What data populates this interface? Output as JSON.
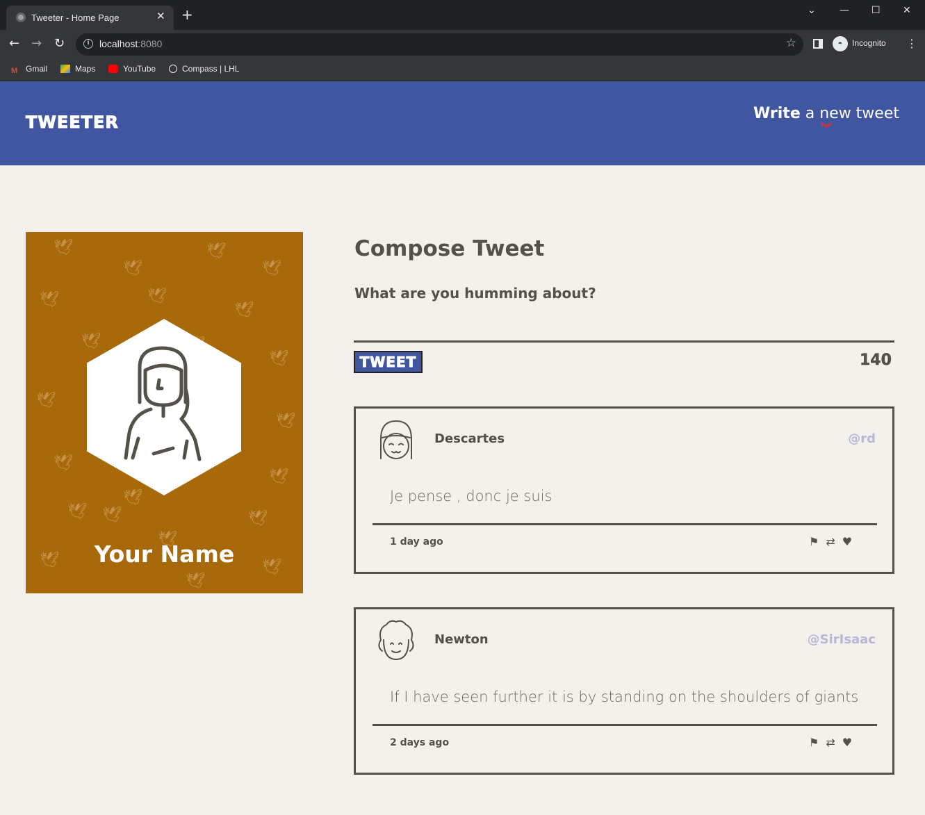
{
  "browser": {
    "tab_title": "Tweeter - Home Page",
    "url_host": "localhost",
    "url_port": ":8080",
    "profile_label": "Incognito",
    "bookmarks": [
      "Gmail",
      "Maps",
      "YouTube",
      "Compass | LHL"
    ]
  },
  "nav": {
    "brand": "TWEETER",
    "write_strong": "Write",
    "write_rest": " a new tweet"
  },
  "profile": {
    "name": "Your Name"
  },
  "compose": {
    "title": "Compose Tweet",
    "prompt": "What are you humming about?",
    "button": "TWEET",
    "counter": "140"
  },
  "tweets": [
    {
      "name": "Descartes",
      "handle": "@rd",
      "content": "Je pense , donc je suis",
      "age": "1 day ago"
    },
    {
      "name": "Newton",
      "handle": "@SirIsaac",
      "content": "If I have seen further it is by standing on the shoulders of giants",
      "age": "2 days ago"
    }
  ],
  "colors": {
    "nav_bg": "#4056a1",
    "accent_red": "#e1312c",
    "profile_bg": "#a8690a",
    "page_bg": "#f4f1ec",
    "text": "#545149",
    "handle": "#b8b8d4"
  }
}
